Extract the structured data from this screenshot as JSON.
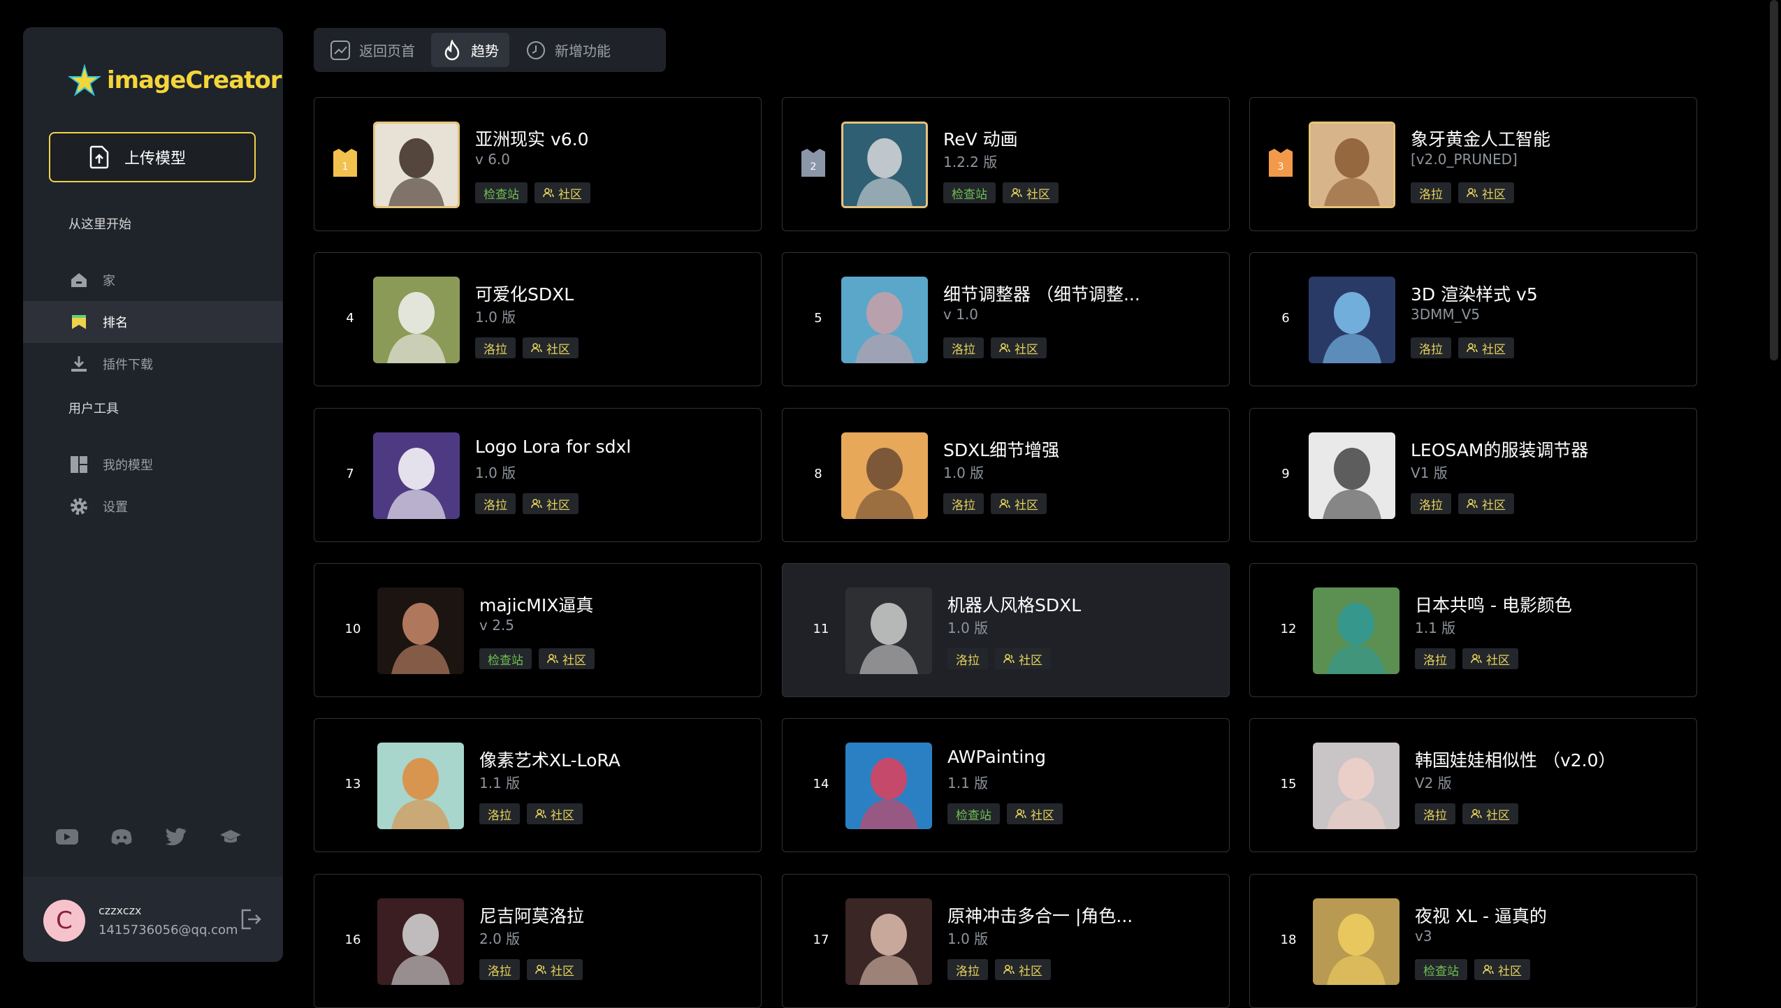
{
  "app": {
    "name": "imageCreator"
  },
  "sidebar": {
    "upload_label": "上传模型",
    "section_start": "从这里开始",
    "nav": [
      {
        "label": "家",
        "icon": "home-icon"
      },
      {
        "label": "排名",
        "icon": "ranking-icon",
        "active": true
      },
      {
        "label": "插件下载",
        "icon": "download-icon"
      }
    ],
    "section_tools": "用户工具",
    "tools": [
      {
        "label": "我的模型",
        "icon": "dashboard-icon"
      },
      {
        "label": "设置",
        "icon": "gear-icon"
      }
    ],
    "social": [
      "youtube-icon",
      "discord-icon",
      "twitter-icon",
      "education-icon"
    ],
    "user": {
      "initial": "C",
      "name": "czzxczx",
      "email": "1415736056@qq.com"
    }
  },
  "tabs": [
    {
      "label": "返回页首",
      "icon": "chart-icon"
    },
    {
      "label": "趋势",
      "icon": "flame-icon",
      "active": true
    },
    {
      "label": "新增功能",
      "icon": "clock-icon"
    }
  ],
  "colors": {
    "accent": "#f0d24a",
    "tag_green": "#6fbf52",
    "tag_yellow": "#e6d35a",
    "gold": "#f2c14e",
    "silver": "#8b96a8",
    "bronze": "#f29a4a"
  },
  "models": [
    {
      "rank": "1",
      "title": "亚洲现实 v6.0",
      "version": "v 6.0",
      "tags": [
        "检查站",
        "社区"
      ]
    },
    {
      "rank": "2",
      "title": "ReV 动画",
      "version": "1.2.2 版",
      "tags": [
        "检查站",
        "社区"
      ]
    },
    {
      "rank": "3",
      "title": "象牙黄金人工智能",
      "version": "[v2.0_PRUNED]",
      "tags": [
        "洛拉",
        "社区"
      ]
    },
    {
      "rank": "4",
      "title": "可爱化SDXL",
      "version": "1.0 版",
      "tags": [
        "洛拉",
        "社区"
      ]
    },
    {
      "rank": "5",
      "title": "细节调整器 （细节调整...",
      "version": "v 1.0",
      "tags": [
        "洛拉",
        "社区"
      ]
    },
    {
      "rank": "6",
      "title": "3D 渲染样式 v5",
      "version": "3DMM_V5",
      "tags": [
        "洛拉",
        "社区"
      ]
    },
    {
      "rank": "7",
      "title": "Logo Lora for sdxl",
      "version": "1.0 版",
      "tags": [
        "洛拉",
        "社区"
      ]
    },
    {
      "rank": "8",
      "title": "SDXL细节增强",
      "version": "1.0 版",
      "tags": [
        "洛拉",
        "社区"
      ]
    },
    {
      "rank": "9",
      "title": "LEOSAM的服装调节器",
      "version": "V1 版",
      "tags": [
        "洛拉",
        "社区"
      ]
    },
    {
      "rank": "10",
      "title": "majicMIX逼真",
      "version": "v 2.5",
      "tags": [
        "检查站",
        "社区"
      ]
    },
    {
      "rank": "11",
      "title": "机器人风格SDXL",
      "version": "1.0 版",
      "tags": [
        "洛拉",
        "社区"
      ]
    },
    {
      "rank": "12",
      "title": "日本共鸣 - 电影颜色",
      "version": "1.1 版",
      "tags": [
        "洛拉",
        "社区"
      ]
    },
    {
      "rank": "13",
      "title": "像素艺术XL-LoRA",
      "version": "1.1 版",
      "tags": [
        "洛拉",
        "社区"
      ]
    },
    {
      "rank": "14",
      "title": "AWPainting",
      "version": "1.1 版",
      "tags": [
        "检查站",
        "社区"
      ]
    },
    {
      "rank": "15",
      "title": "韩国娃娃相似性 （v2.0）",
      "version": "V2 版",
      "tags": [
        "洛拉",
        "社区"
      ]
    },
    {
      "rank": "16",
      "title": "尼吉阿莫洛拉",
      "version": "2.0 版",
      "tags": [
        "洛拉",
        "社区"
      ]
    },
    {
      "rank": "17",
      "title": "原神冲击多合一 |角色...",
      "version": "1.0 版",
      "tags": [
        "洛拉",
        "社区"
      ]
    },
    {
      "rank": "18",
      "title": "夜视 XL - 逼真的",
      "version": "v3",
      "tags": [
        "检查站",
        "社区"
      ]
    }
  ],
  "thumbs": [
    {
      "bg": "#e8e2d6",
      "fg": "#3a2a22"
    },
    {
      "bg": "#2f5f72",
      "fg": "#d8d8dc"
    },
    {
      "bg": "#d8b48a",
      "fg": "#8a5a32"
    },
    {
      "bg": "#8c9a58",
      "fg": "#f2f2f2"
    },
    {
      "bg": "#5aa7c9",
      "fg": "#c9a0a8"
    },
    {
      "bg": "#2a3a66",
      "fg": "#7fc3f0"
    },
    {
      "bg": "#4e3a82",
      "fg": "#ffffff"
    },
    {
      "bg": "#e7a85a",
      "fg": "#6a4a32"
    },
    {
      "bg": "#e9e9e9",
      "fg": "#444444"
    },
    {
      "bg": "#1b1411",
      "fg": "#c98a6a"
    },
    {
      "bg": "#2d2f33",
      "fg": "#cfcfcf"
    },
    {
      "bg": "#5c8f52",
      "fg": "#2f9a98"
    },
    {
      "bg": "#a8d6cc",
      "fg": "#e08a3a"
    },
    {
      "bg": "#2b80c4",
      "fg": "#e0405a"
    },
    {
      "bg": "#c9c4c6",
      "fg": "#f0d0c8"
    },
    {
      "bg": "#3a1e22",
      "fg": "#d8d8d8"
    },
    {
      "bg": "#3a2624",
      "fg": "#e0c0b0"
    },
    {
      "bg": "#b89a52",
      "fg": "#f0d060"
    }
  ]
}
